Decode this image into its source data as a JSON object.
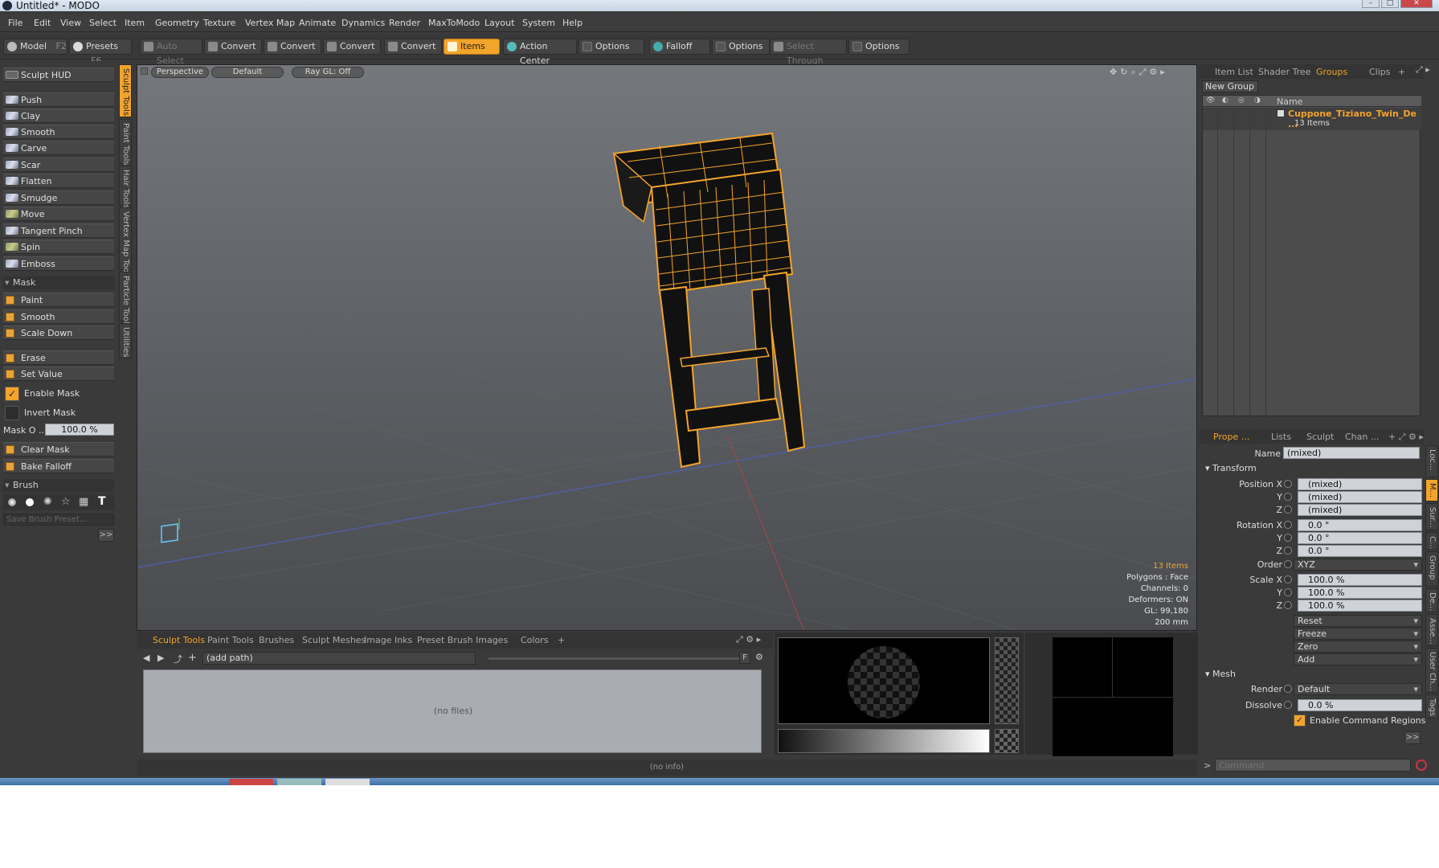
{
  "window": {
    "title": "Untitled* - MODO",
    "min": "–",
    "max": "□",
    "close": "✕"
  },
  "menu": [
    "File",
    "Edit",
    "View",
    "Select",
    "Item",
    "Geometry",
    "Texture",
    "Vertex Map",
    "Animate",
    "Dynamics",
    "Render",
    "MaxToModo",
    "Layout",
    "System",
    "Help"
  ],
  "toolbar": {
    "model": "Model",
    "model_key": "F2",
    "presets": "Presets",
    "presets_key": "F6",
    "auto_select": "Auto Select",
    "convert": "Convert",
    "items": "Items",
    "action_center": "Action Center",
    "options": "Options",
    "falloff": "Falloff",
    "select_through": "Select Through"
  },
  "left": {
    "sculpt_hud": "Sculpt HUD",
    "tools": [
      "Push",
      "Clay",
      "Smooth",
      "Carve",
      "Scar",
      "Flatten",
      "Smudge",
      "Move",
      "Tangent Pinch",
      "Spin",
      "Emboss"
    ],
    "mask_header": "Mask",
    "mask_tools": [
      "Paint",
      "Smooth",
      "Scale Down"
    ],
    "erase": "Erase",
    "set_value": "Set Value",
    "enable_mask": "Enable Mask",
    "invert_mask": "Invert Mask",
    "mask_opacity_label": "Mask O ...",
    "mask_opacity_value": "100.0 %",
    "clear_mask": "Clear Mask",
    "bake_falloff": "Bake Falloff",
    "brush_header": "Brush",
    "save_brush_preset": "Save Brush Preset...",
    "expand": ">>",
    "vtabs": [
      "Sculpt Tools",
      "Paint Tools",
      "Hair Tools",
      "Vertex Map Tools",
      "Particle Tools",
      "Utilities"
    ]
  },
  "viewport": {
    "perspective": "Perspective",
    "default": "Default",
    "raygl": "Ray GL: Off",
    "info": {
      "items": "13 Items",
      "polygons": "Polygons : Face",
      "channels": "Channels: 0",
      "deformers": "Deformers: ON",
      "gl": "GL: 99,180",
      "scale": "200 mm"
    }
  },
  "bottom": {
    "tabs": [
      "Sculpt Tools",
      "Paint Tools",
      "Brushes",
      "Sculpt Meshes",
      "Image Inks",
      "Preset Brush",
      "Images",
      "Colors",
      "+"
    ],
    "path": "(add path)",
    "no_files": "(no files)",
    "f_label": "F"
  },
  "status": "(no info)",
  "right": {
    "top_tabs": [
      "Item List",
      "Shader Tree",
      "Groups",
      "Clips"
    ],
    "new_group": "New Group",
    "name_col": "Name",
    "group_name": "Cuppone_Tiziano_Twin_De ...",
    "group_count": "13 Items",
    "prop_tabs": [
      "Prope ...",
      "Lists",
      "Sculpt",
      "Chan ..."
    ],
    "name_label": "Name",
    "name_value": "(mixed)",
    "transform": "Transform",
    "position_x": "Position X",
    "y": "Y",
    "z": "Z",
    "pos": [
      "(mixed)",
      "(mixed)",
      "(mixed)"
    ],
    "rotation_x": "Rotation X",
    "rot": [
      "0.0 °",
      "0.0 °",
      "0.0 °"
    ],
    "order_label": "Order",
    "order_value": "XYZ",
    "scale_x": "Scale X",
    "scale": [
      "100.0 %",
      "100.0 %",
      "100.0 %"
    ],
    "actions": [
      "Reset",
      "Freeze",
      "Zero",
      "Add"
    ],
    "mesh": "Mesh",
    "render_label": "Render",
    "render_value": "Default",
    "dissolve_label": "Dissolve",
    "dissolve_value": "0.0 %",
    "enable_cmd_regions": "Enable Command Regions",
    "expand": ">>",
    "side_tabs": [
      "Loc...",
      "M...",
      "Sur...",
      "C...",
      "Group",
      "De...",
      "Asse...",
      "User Ch...",
      "Tags"
    ],
    "command_placeholder": "Command"
  },
  "colors": {
    "accent": "#f3a42b",
    "bg": "#3a3a3a"
  }
}
